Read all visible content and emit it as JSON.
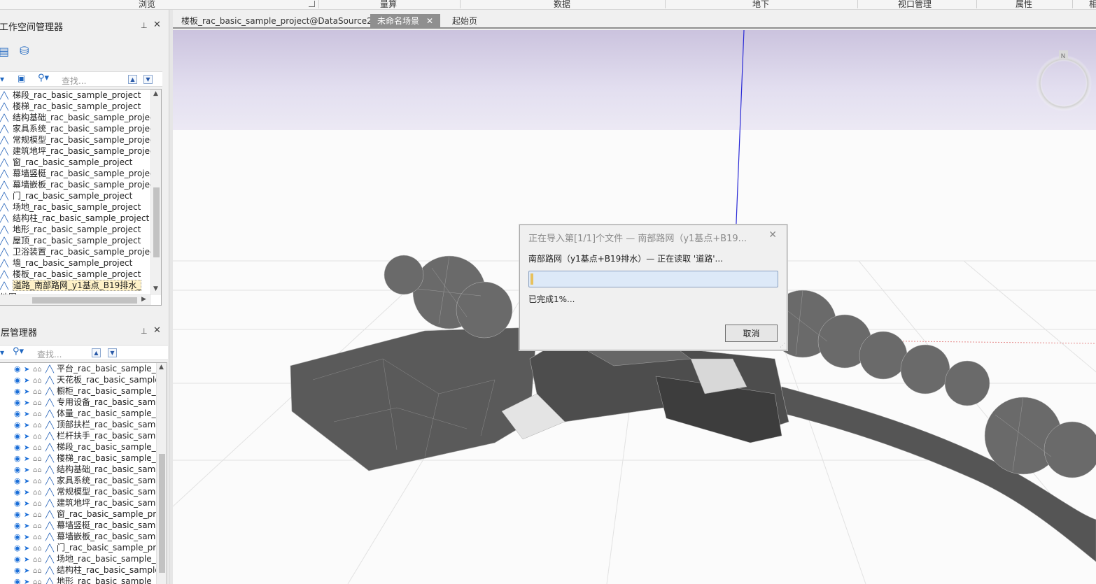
{
  "ribbon": {
    "groups": [
      {
        "label": "浏览"
      },
      {
        "label": "量算"
      },
      {
        "label": "数据"
      },
      {
        "label": "地下"
      },
      {
        "label": "视口管理"
      },
      {
        "label": "属性"
      },
      {
        "label": "相"
      }
    ]
  },
  "workspace": {
    "title": "工作空间管理器",
    "search_placeholder": "查找...",
    "items": [
      {
        "label": "梯段_rac_basic_sample_project"
      },
      {
        "label": "楼梯_rac_basic_sample_project"
      },
      {
        "label": "结构基础_rac_basic_sample_project"
      },
      {
        "label": "家具系统_rac_basic_sample_project"
      },
      {
        "label": "常规模型_rac_basic_sample_project"
      },
      {
        "label": "建筑地坪_rac_basic_sample_project"
      },
      {
        "label": "窗_rac_basic_sample_project"
      },
      {
        "label": "幕墙竖梃_rac_basic_sample_project"
      },
      {
        "label": "幕墙嵌板_rac_basic_sample_project"
      },
      {
        "label": "门_rac_basic_sample_project"
      },
      {
        "label": "场地_rac_basic_sample_project"
      },
      {
        "label": "结构柱_rac_basic_sample_project"
      },
      {
        "label": "地形_rac_basic_sample_project"
      },
      {
        "label": "屋顶_rac_basic_sample_project"
      },
      {
        "label": "卫浴装置_rac_basic_sample_project"
      },
      {
        "label": "墙_rac_basic_sample_project"
      },
      {
        "label": "楼板_rac_basic_sample_project"
      },
      {
        "label": "道路_南部路网_y1基点_B19排水_"
      }
    ],
    "partial_item": "地图"
  },
  "layers": {
    "title": "图层管理器",
    "search_placeholder": "查找...",
    "items": [
      {
        "label": "平台_rac_basic_sample_p"
      },
      {
        "label": "天花板_rac_basic_sample_"
      },
      {
        "label": "橱柜_rac_basic_sample_p"
      },
      {
        "label": "专用设备_rac_basic_samp"
      },
      {
        "label": "体量_rac_basic_sample_p"
      },
      {
        "label": "顶部扶栏_rac_basic_samp"
      },
      {
        "label": "栏杆扶手_rac_basic_samp"
      },
      {
        "label": "梯段_rac_basic_sample_p"
      },
      {
        "label": "楼梯_rac_basic_sample_p"
      },
      {
        "label": "结构基础_rac_basic_samp"
      },
      {
        "label": "家具系统_rac_basic_samp"
      },
      {
        "label": "常规模型_rac_basic_samp"
      },
      {
        "label": "建筑地坪_rac_basic_samp"
      },
      {
        "label": "窗_rac_basic_sample_proj"
      },
      {
        "label": "幕墙竖梃_rac_basic_samp"
      },
      {
        "label": "幕墙嵌板_rac_basic_samp"
      },
      {
        "label": "门_rac_basic_sample_proj"
      },
      {
        "label": "场地_rac_basic_sample_p"
      },
      {
        "label": "结构柱_rac_basic_sample"
      },
      {
        "label": "地形_rac_basic_sample_p"
      }
    ]
  },
  "tabs": [
    {
      "label": "楼板_rac_basic_sample_project@DataSource21",
      "active": false
    },
    {
      "label": "未命名场景",
      "active": true
    },
    {
      "label": "起始页",
      "active": false
    }
  ],
  "tab_close": "✕",
  "compass_label": "N",
  "dialog": {
    "title": "正在导入第[1/1]个文件 — 南部路网（y1基点+B19...",
    "message": "南部路网（y1基点+B19排水）— 正在读取 '道路'...",
    "progress": 0.01,
    "percent_text": "已完成1%...",
    "cancel_label": "取消"
  },
  "colors": {
    "accent": "#1f5fb8",
    "tab_active": "#8f8f8f",
    "sky_top": "#c9c2dc",
    "progress_bg": "#dde9f8",
    "progress_fill": "#e8c15c"
  }
}
